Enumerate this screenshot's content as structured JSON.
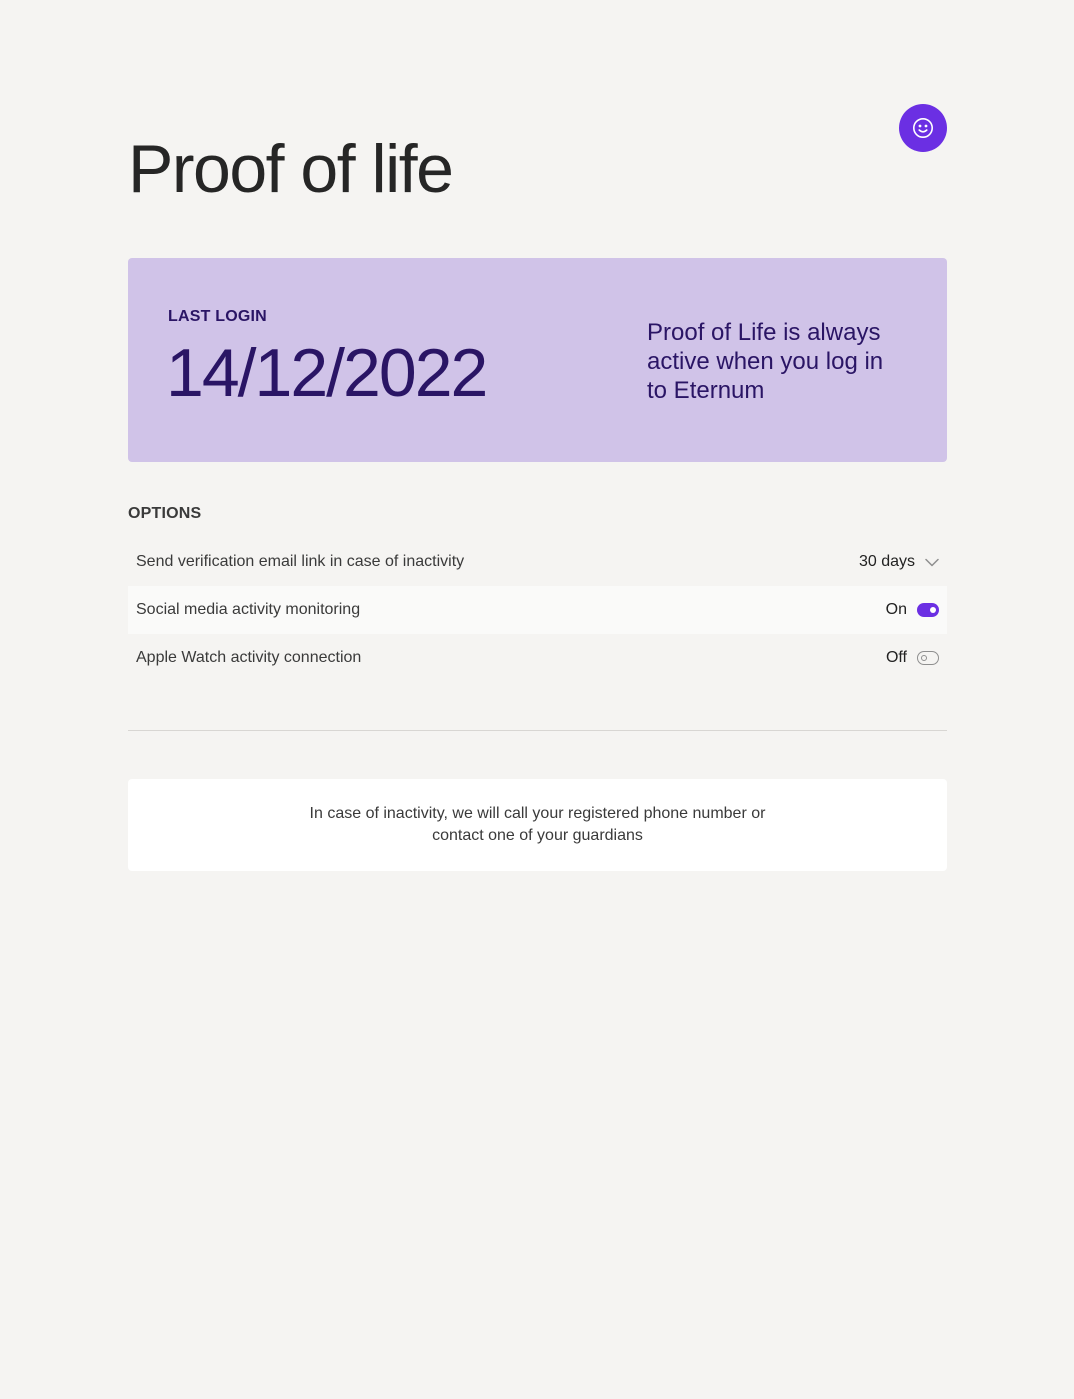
{
  "header": {
    "title": "Proof of life",
    "avatar_icon": "smiley-face-icon"
  },
  "login_card": {
    "label": "LAST LOGIN",
    "date": "14/12/2022",
    "note": "Proof of Life is always active when you log in to Eternum"
  },
  "options": {
    "heading": "OPTIONS",
    "items": [
      {
        "label": "Send verification email link in case of inactivity",
        "value": "30 days",
        "control": "dropdown",
        "icon": "chevron-down-icon"
      },
      {
        "label": "Social media activity monitoring",
        "value": "On",
        "control": "toggle",
        "state": true
      },
      {
        "label": "Apple Watch activity connection",
        "value": "Off",
        "control": "toggle",
        "state": false
      }
    ]
  },
  "info": {
    "text": "In case of inactivity, we will call your registered phone number or contact one of your guardians"
  },
  "colors": {
    "accent": "#6b2fe3",
    "card_background": "#d0c3e8",
    "card_text": "#2a1565",
    "page_background": "#f5f4f2"
  }
}
